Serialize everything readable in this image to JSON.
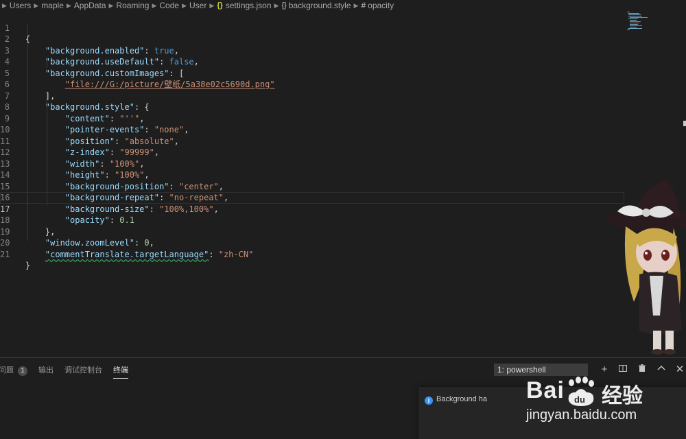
{
  "breadcrumb": {
    "items": [
      "Users",
      "maple",
      "AppData",
      "Roaming",
      "Code",
      "User"
    ],
    "file_icon": "{}",
    "file": "settings.json",
    "object_icon": "{}",
    "object": "background.style",
    "property_icon": "#",
    "property": "opacity"
  },
  "line_numbers": [
    "1",
    "2",
    "3",
    "4",
    "5",
    "6",
    "7",
    "8",
    "9",
    "10",
    "11",
    "12",
    "13",
    "14",
    "15",
    "16",
    "17",
    "18",
    "19",
    "20",
    "21"
  ],
  "code": {
    "open_brace": "{",
    "enabled_key": "\"background.enabled\"",
    "enabled_val": "true",
    "usedefault_key": "\"background.useDefault\"",
    "usedefault_val": "false",
    "customimages_key": "\"background.customImages\"",
    "array_open": "[",
    "image_path": "\"file:///G:/picture/壁纸/5a38e02c5690d.png\"",
    "array_close": "],",
    "style_key": "\"background.style\"",
    "style_open": "{",
    "content_key": "\"content\"",
    "content_val": "\"''\"",
    "pointer_key": "\"pointer-events\"",
    "pointer_val": "\"none\"",
    "position_key": "\"position\"",
    "position_val": "\"absolute\"",
    "zindex_key": "\"z-index\"",
    "zindex_val": "\"99999\"",
    "width_key": "\"width\"",
    "width_val": "\"100%\"",
    "height_key": "\"height\"",
    "height_val": "\"100%\"",
    "bgpos_key": "\"background-position\"",
    "bgpos_val": "\"center\"",
    "bgrepeat_key": "\"background-repeat\"",
    "bgrepeat_val": "\"no-repeat\"",
    "bgsize_key": "\"background-size\"",
    "bgsize_val": "\"100%,100%\"",
    "opacity_key": "\"opacity\"",
    "opacity_val": "0.1",
    "style_close": "},",
    "zoom_key": "\"window.zoomLevel\"",
    "zoom_val": "0",
    "translate_key": "\"commentTranslate.targetLanguage\"",
    "translate_val": "\"zh-CN\"",
    "close_brace": "}"
  },
  "panel": {
    "tabs": [
      "问题",
      "输出",
      "调试控制台",
      "终端"
    ],
    "problems_count": "1",
    "active_tab": "终端",
    "terminal_select": "1: powershell",
    "notification_text": "Background ha"
  },
  "watermark": {
    "brand": "Bai",
    "brand_cn": "经验",
    "url": "jingyan.baidu.com"
  },
  "colors": {
    "background": "#1e1e1e",
    "key": "#9cdcfe",
    "string": "#ce9178",
    "boolean": "#569cd6",
    "number": "#b5cea8",
    "info": "#3794ff"
  },
  "icons": {
    "add": "plus-icon",
    "split": "split-terminal-icon",
    "trash": "trash-icon",
    "maximize": "chevron-up-icon",
    "close": "close-icon"
  }
}
